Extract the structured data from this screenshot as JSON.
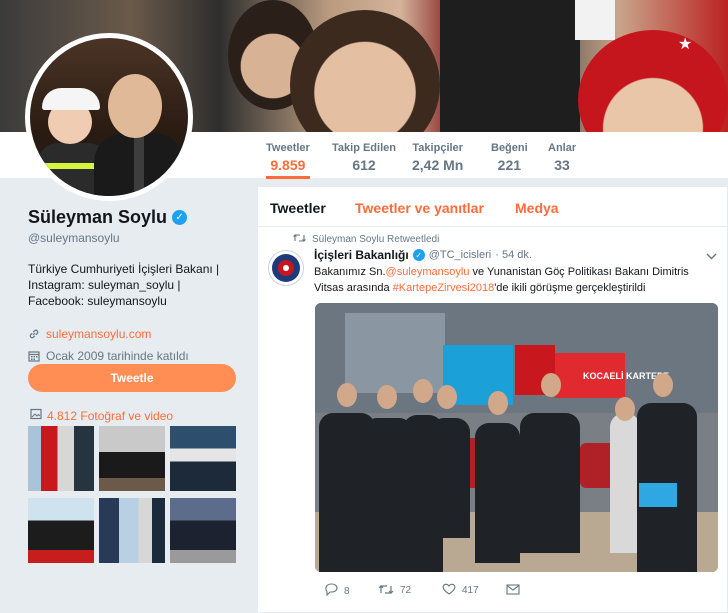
{
  "profile": {
    "name": "Süleyman Soylu",
    "handle": "@suleymansoylu",
    "bio": "Türkiye Cumhuriyeti İçişleri Bakanı | Instagram: suleyman_soylu | Facebook: suleymansoylu",
    "website": "suleymansoylu.com",
    "joined": "Ocak 2009 tarihinde katıldı",
    "tweet_button": "Tweetle",
    "media_link": "4.812 Fotoğraf ve video"
  },
  "stats": [
    {
      "label": "Tweetler",
      "value": "9.859"
    },
    {
      "label": "Takip Edilen",
      "value": "612"
    },
    {
      "label": "Takipçiler",
      "value": "2,42 Mn"
    },
    {
      "label": "Beğeni",
      "value": "221"
    },
    {
      "label": "Anlar",
      "value": "33"
    }
  ],
  "tabs": {
    "tweets": "Tweetler",
    "replies": "Tweetler ve yanıtlar",
    "media": "Medya"
  },
  "tweet": {
    "retweet_line": "Süleyman Soylu Retweetledi",
    "author_name": "İçişleri Bakanlığı",
    "author_handle": "@TC_icisleri",
    "time": "· 54 dk.",
    "text_1": "Bakanımız Sn.",
    "mention": "@suleymansoylu",
    "text_2": " ve Yunanistan Göç Politikası Bakanı Dimitris Vitsas arasında ",
    "hashtag": "#KartepeZirvesi2018",
    "text_3": "'de ikili görüşme gerçekleştirildi",
    "photo_caption": "KOCAELİ KARTEPE",
    "replies": "8",
    "retweets": "72",
    "likes": "417"
  },
  "colors": {
    "accent": "#ff6c3a",
    "verified": "#1da1f2"
  }
}
